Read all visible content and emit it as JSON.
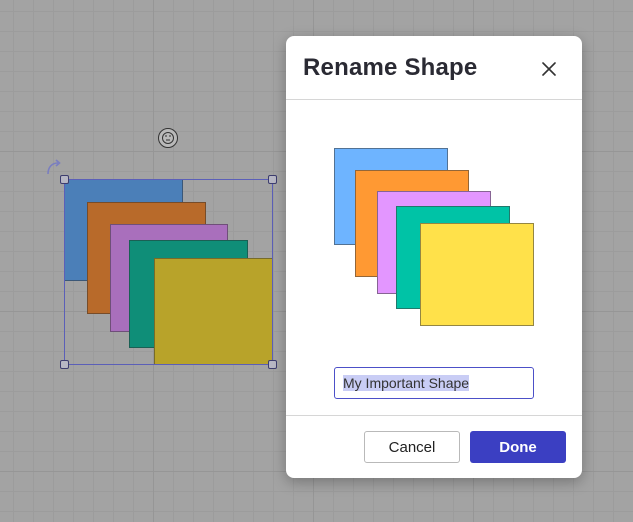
{
  "dialog": {
    "title": "Rename Shape",
    "input_value": "My Important Shape",
    "cancel_label": "Cancel",
    "done_label": "Done"
  },
  "canvas": {
    "badge_text": "ꟷ"
  },
  "colors": {
    "blue": "#6eb4ff",
    "orange": "#ff9933",
    "purple": "#e396ff",
    "teal": "#00c3a6",
    "yellow": "#ffe14a",
    "primary": "#3b3fc2"
  }
}
